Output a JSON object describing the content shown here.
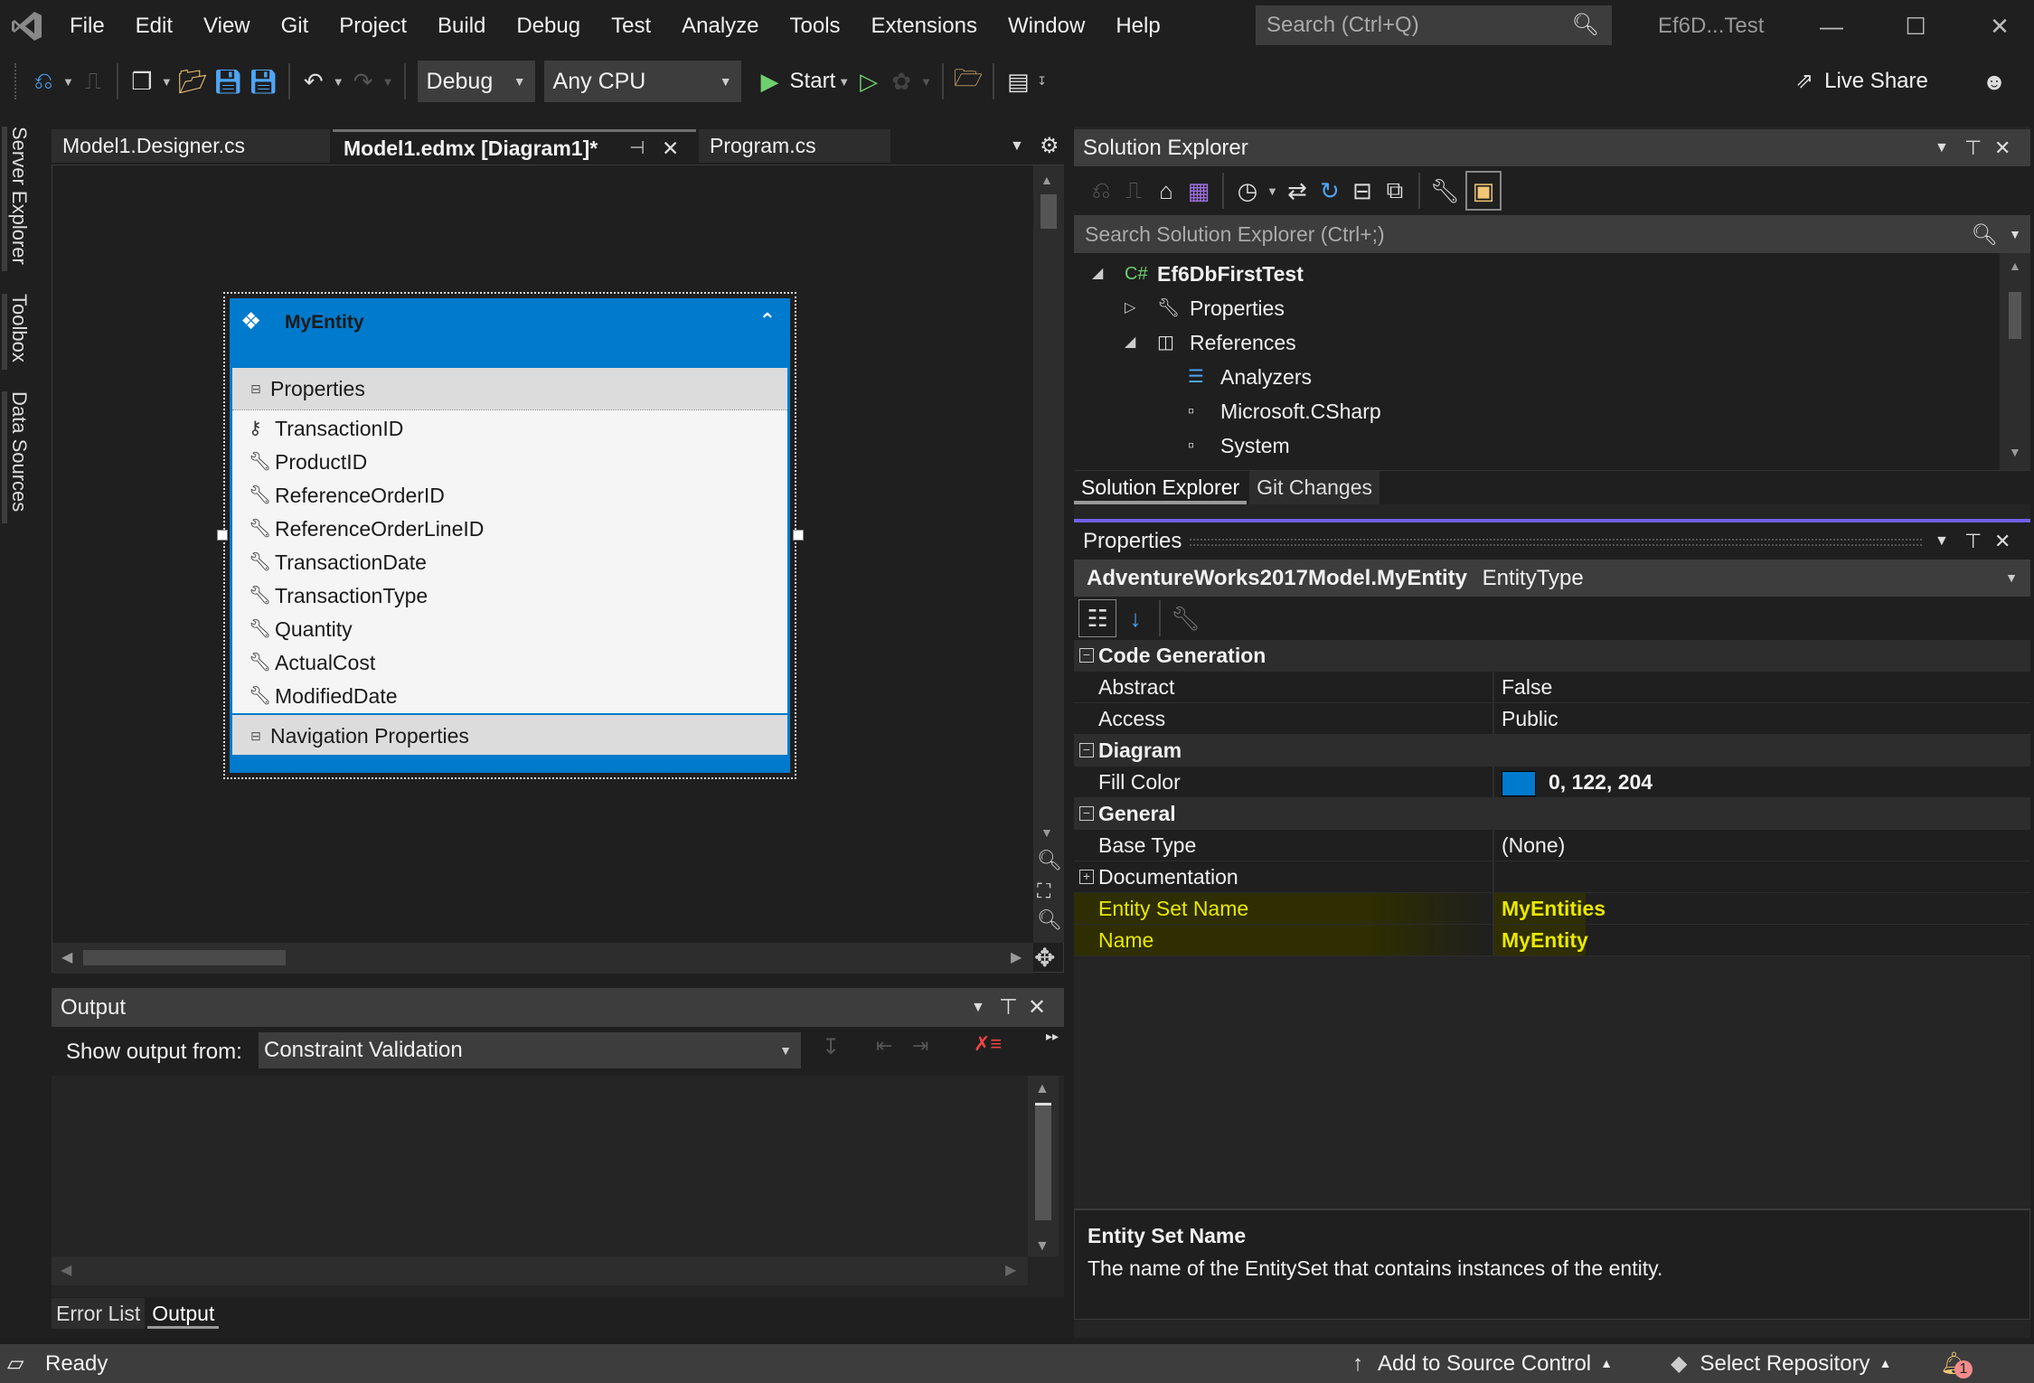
{
  "menubar": {
    "items": [
      "File",
      "Edit",
      "View",
      "Git",
      "Project",
      "Build",
      "Debug",
      "Test",
      "Analyze",
      "Tools",
      "Extensions",
      "Window",
      "Help"
    ],
    "search_placeholder": "Search (Ctrl+Q)",
    "window_title": "Ef6D...Test"
  },
  "toolbar": {
    "config": "Debug",
    "platform": "Any CPU",
    "start_label": "Start",
    "live_share": "Live Share"
  },
  "side_tabs": [
    "Server Explorer",
    "Toolbox",
    "Data Sources"
  ],
  "doc_tabs": [
    {
      "label": "Model1.Designer.cs",
      "active": false
    },
    {
      "label": "Model1.edmx [Diagram1]*",
      "active": true
    },
    {
      "label": "Program.cs",
      "active": false
    }
  ],
  "entity": {
    "name": "MyEntity",
    "properties_header": "Properties",
    "properties": [
      {
        "name": "TransactionID",
        "key": true
      },
      {
        "name": "ProductID",
        "key": false
      },
      {
        "name": "ReferenceOrderID",
        "key": false
      },
      {
        "name": "ReferenceOrderLineID",
        "key": false
      },
      {
        "name": "TransactionDate",
        "key": false
      },
      {
        "name": "TransactionType",
        "key": false
      },
      {
        "name": "Quantity",
        "key": false
      },
      {
        "name": "ActualCost",
        "key": false
      },
      {
        "name": "ModifiedDate",
        "key": false
      }
    ],
    "nav_header": "Navigation Properties",
    "fill_color": "#007acc"
  },
  "output": {
    "title": "Output",
    "show_from_label": "Show output from:",
    "source": "Constraint Validation"
  },
  "bottom_tabs": [
    {
      "label": "Error List",
      "active": false
    },
    {
      "label": "Output",
      "active": true
    }
  ],
  "status": {
    "ready": "Ready",
    "source_control": "Add to Source Control",
    "repo": "Select Repository",
    "notifications": "1"
  },
  "solution_explorer": {
    "title": "Solution Explorer",
    "search_placeholder": "Search Solution Explorer (Ctrl+;)",
    "tree": [
      {
        "label": "Ef6DbFirstTest",
        "level": 0,
        "expand": "open",
        "icon": "csharp-project-icon",
        "bold": true
      },
      {
        "label": "Properties",
        "level": 1,
        "expand": "closed",
        "icon": "wrench-icon",
        "bold": false
      },
      {
        "label": "References",
        "level": 1,
        "expand": "open",
        "icon": "references-icon",
        "bold": false
      },
      {
        "label": "Analyzers",
        "level": 2,
        "expand": "none",
        "icon": "analyzers-icon",
        "bold": false
      },
      {
        "label": "Microsoft.CSharp",
        "level": 2,
        "expand": "none",
        "icon": "assembly-icon",
        "bold": false
      },
      {
        "label": "System",
        "level": 2,
        "expand": "none",
        "icon": "assembly-icon",
        "bold": false
      }
    ],
    "tabs": [
      {
        "label": "Solution Explorer",
        "active": true
      },
      {
        "label": "Git Changes",
        "active": false
      }
    ]
  },
  "properties_panel": {
    "title": "Properties",
    "object_name": "AdventureWorks2017Model.MyEntity",
    "object_type": "EntityType",
    "categories": [
      {
        "name": "Code Generation",
        "rows": [
          {
            "key": "Abstract",
            "value": "False",
            "highlight": false
          },
          {
            "key": "Access",
            "value": "Public",
            "highlight": false
          }
        ]
      },
      {
        "name": "Diagram",
        "rows": [
          {
            "key": "Fill Color",
            "value": "0, 122, 204",
            "highlight": false,
            "swatch": "#007acc"
          }
        ]
      },
      {
        "name": "General",
        "rows": [
          {
            "key": "Base Type",
            "value": "(None)",
            "highlight": false
          },
          {
            "key": "Documentation",
            "value": "",
            "highlight": false,
            "expandable": true
          },
          {
            "key": "Entity Set Name",
            "value": "MyEntities",
            "highlight": true
          },
          {
            "key": "Name",
            "value": "MyEntity",
            "highlight": true
          }
        ]
      }
    ],
    "description_title": "Entity Set Name",
    "description_text": "The name of the EntitySet that contains instances of the entity."
  },
  "colors": {
    "accent": "#007acc",
    "highlight_text": "#e8e800",
    "highlight_bg": "#2e2e00",
    "panel_accent": "#7160e8"
  }
}
